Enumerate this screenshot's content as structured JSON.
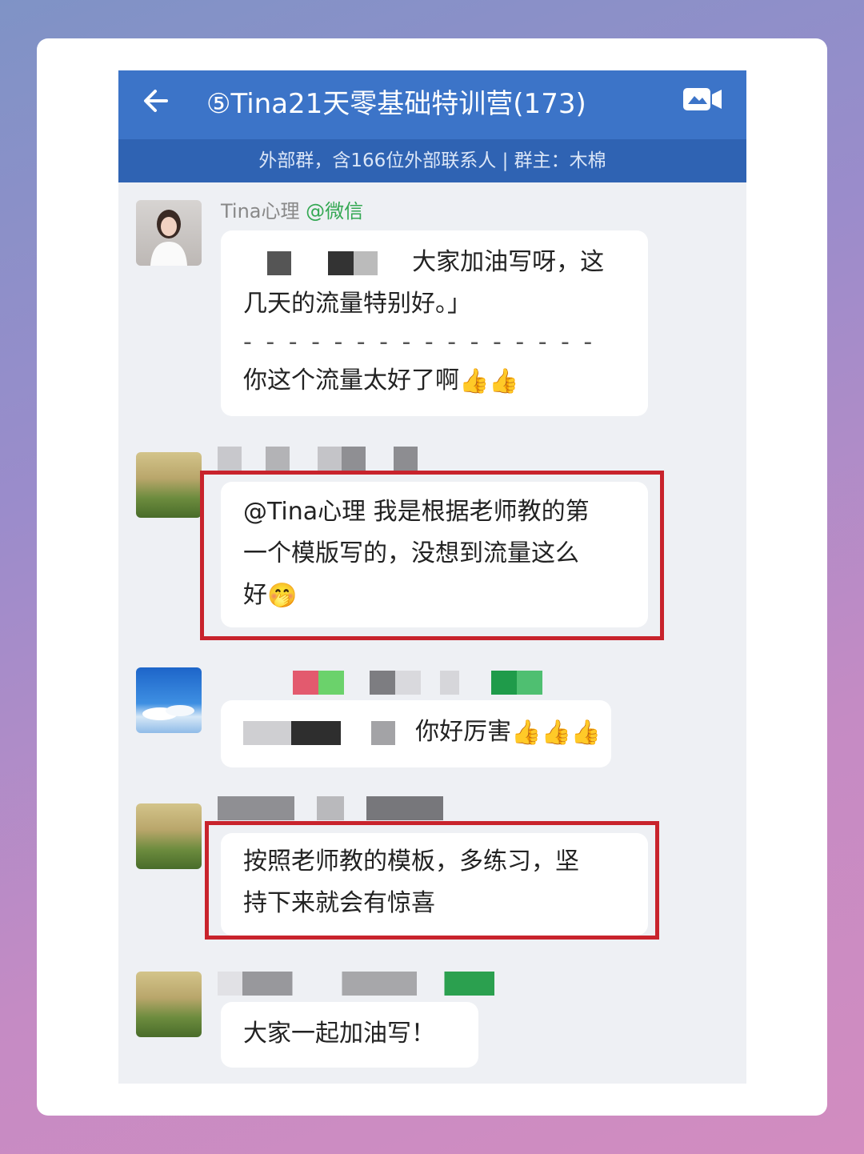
{
  "header": {
    "title": "⑤Tina21天零基础特训营(173)",
    "subtitle": "外部群，含166位外部联系人 | 群主：木棉"
  },
  "messages": [
    {
      "sender": "Tina心理",
      "sender_tag": "@微信",
      "line1": "大家加油写呀，这",
      "line2": "几天的流量特别好。」",
      "divider": "- - - - - - - - - - - - - - - -",
      "line3": "你这个流量太好了啊",
      "emoji": "👍👍"
    },
    {
      "line1": "@Tina心理 我是根据老师教的第",
      "line2": "一个模版写的，没想到流量这么",
      "line3": "好",
      "emoji": "🤭"
    },
    {
      "text": "你好厉害",
      "emoji": "👍👍👍"
    },
    {
      "line1": "按照老师教的模板，多练习，坚",
      "line2": "持下来就会有惊喜"
    },
    {
      "text": "大家一起加油写！"
    }
  ],
  "icons": {
    "back": "arrow-left-icon",
    "video": "video-camera-icon"
  },
  "colors": {
    "header_bg": "#3c74c8",
    "subheader_bg": "#2f63b3",
    "highlight_border": "#c8232c",
    "wechat_tag": "#34a853"
  }
}
